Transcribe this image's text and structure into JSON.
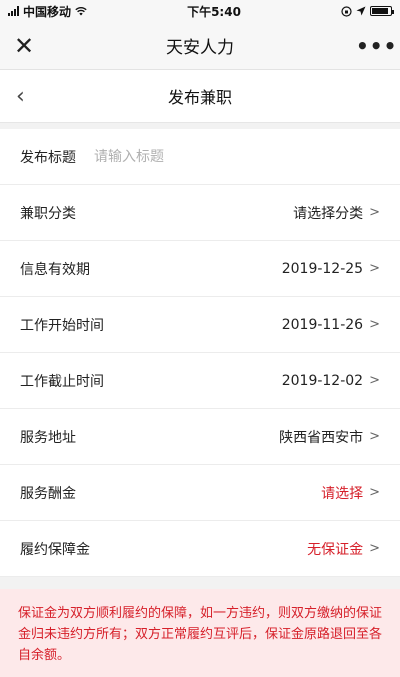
{
  "status_bar": {
    "carrier": "中国移动",
    "time": "下午5:40"
  },
  "wechat_bar": {
    "close_icon": "close-icon",
    "title": "天安人力",
    "more_icon": "more-icon"
  },
  "nav": {
    "back_icon": "chevron-left-icon",
    "title": "发布兼职"
  },
  "form": {
    "title_field": {
      "label": "发布标题",
      "placeholder": "请输入标题"
    },
    "category": {
      "label": "兼职分类",
      "value": "请选择分类"
    },
    "validity": {
      "label": "信息有效期",
      "value": "2019-12-25"
    },
    "start_time": {
      "label": "工作开始时间",
      "value": "2019-11-26"
    },
    "end_time": {
      "label": "工作截止时间",
      "value": "2019-12-02"
    },
    "address": {
      "label": "服务地址",
      "value": "陕西省西安市"
    },
    "reward": {
      "label": "服务酬金",
      "value": "请选择"
    },
    "deposit": {
      "label": "履约保障金",
      "value": "无保证金"
    }
  },
  "notice": "保证金为双方顺利履约的保障，如一方违约，则双方缴纳的保证 金归未违约方所有；双方正常履约互评后，保证金原路退回至各 自余额。",
  "colors": {
    "accent_red": "#d6202a",
    "notice_bg": "#fde9ea"
  }
}
